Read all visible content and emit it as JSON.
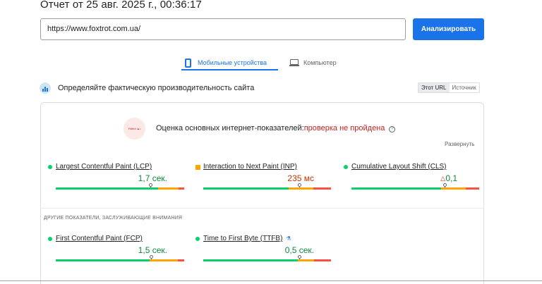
{
  "report": {
    "title": "Отчет от 25 авг. 2025 г., 00:36:17"
  },
  "search": {
    "url": "https://www.foxtrot.com.ua/",
    "analyze_label": "Анализировать"
  },
  "tabs": {
    "mobile": "Мобильные устройства",
    "desktop": "Компьютер"
  },
  "crux": {
    "heading": "Определяйте фактическую производительность сайта",
    "toggle_url": "Этот URL",
    "toggle_origin": "Источник"
  },
  "cwv": {
    "heading": "Оценка основных интернет-показателей:",
    "status": "проверка не пройдена",
    "badge_text": "Failed ▲•",
    "expand_label": "Развернуть"
  },
  "metrics": [
    {
      "label": "Largest Contentful Paint (LCP)",
      "value": "1,7 сек.",
      "rating": "good"
    },
    {
      "label": "Interaction to Next Paint (INP)",
      "value": "235 мс",
      "rating": "average"
    },
    {
      "label": "Cumulative Layout Shift (CLS)",
      "value": "0,1",
      "rating": "good"
    }
  ],
  "other": {
    "heading": "ДРУГИЕ ПОКАЗАТЕЛИ, ЗАСЛУЖИВАЮЩИЕ ВНИМАНИЯ",
    "metrics": [
      {
        "label": "First Contentful Paint (FCP)",
        "value": "1,5 сек.",
        "rating": "good"
      },
      {
        "label": "Time to First Byte (TTFB)",
        "value": "0,5 сек.",
        "rating": "good"
      }
    ]
  },
  "colors": {
    "accent": "#1a73e8",
    "fail": "#c5221f",
    "good": "#0cce6b",
    "average": "#ffa400",
    "poor": "#ff4e42"
  }
}
